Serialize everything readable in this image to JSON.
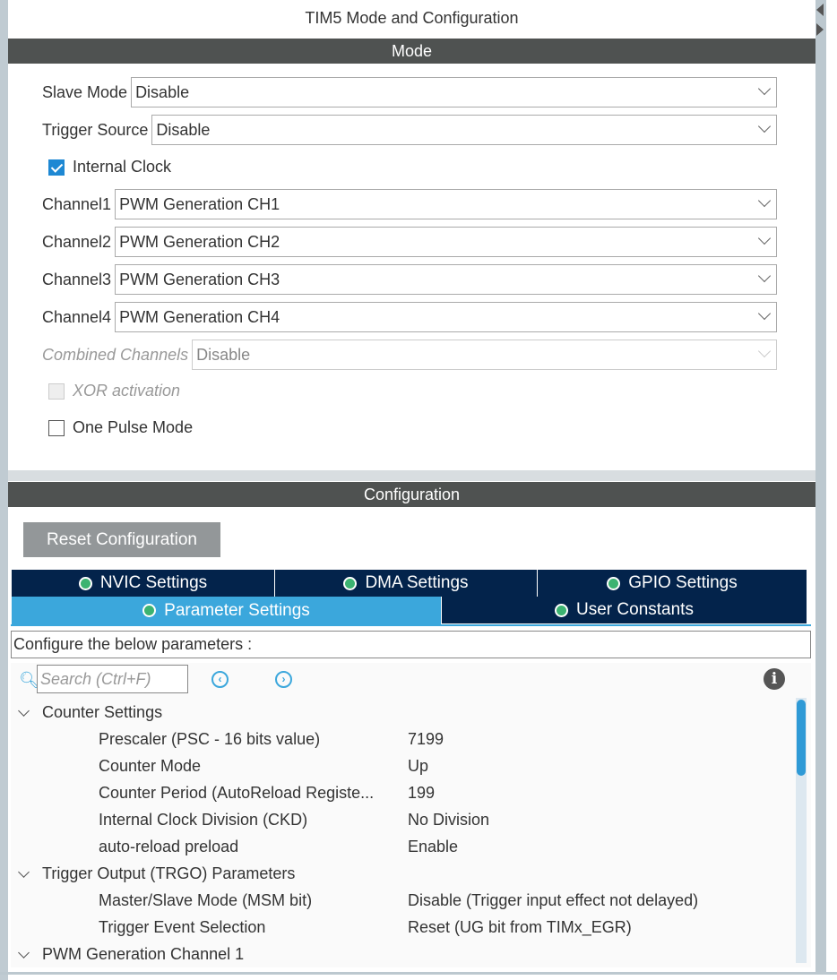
{
  "title": "TIM5 Mode and Configuration",
  "mode_header": "Mode",
  "mode": {
    "slave_mode": {
      "label": "Slave Mode",
      "value": "Disable"
    },
    "trigger_source": {
      "label": "Trigger Source",
      "value": "Disable"
    },
    "internal_clock": {
      "label": "Internal Clock",
      "checked": true
    },
    "channels": [
      {
        "label": "Channel1",
        "value": "PWM Generation CH1"
      },
      {
        "label": "Channel2",
        "value": "PWM Generation CH2"
      },
      {
        "label": "Channel3",
        "value": "PWM Generation CH3"
      },
      {
        "label": "Channel4",
        "value": "PWM Generation CH4"
      }
    ],
    "combined_channels": {
      "label": "Combined Channels",
      "value": "Disable"
    },
    "xor_activation": {
      "label": "XOR activation",
      "checked": false
    },
    "one_pulse_mode": {
      "label": "One Pulse Mode",
      "checked": false
    }
  },
  "config_header": "Configuration",
  "reset_button": "Reset Configuration",
  "tabs": [
    "NVIC Settings",
    "DMA Settings",
    "GPIO Settings",
    "Parameter Settings",
    "User Constants"
  ],
  "active_tab": "Parameter Settings",
  "description": "Configure the below parameters :",
  "search_placeholder": "Search (Ctrl+F)",
  "groups": [
    {
      "name": "Counter Settings",
      "params": [
        {
          "name": "Prescaler (PSC - 16 bits value)",
          "value": "7199"
        },
        {
          "name": "Counter Mode",
          "value": "Up"
        },
        {
          "name": "Counter Period (AutoReload Registe...",
          "value": "199"
        },
        {
          "name": "Internal Clock Division (CKD)",
          "value": "No Division"
        },
        {
          "name": "auto-reload preload",
          "value": "Enable"
        }
      ]
    },
    {
      "name": "Trigger Output (TRGO) Parameters",
      "params": [
        {
          "name": "Master/Slave Mode (MSM bit)",
          "value": "Disable (Trigger input effect not delayed)"
        },
        {
          "name": "Trigger Event Selection",
          "value": "Reset (UG bit from TIMx_EGR)"
        }
      ]
    },
    {
      "name": "PWM Generation Channel 1",
      "params": []
    }
  ]
}
